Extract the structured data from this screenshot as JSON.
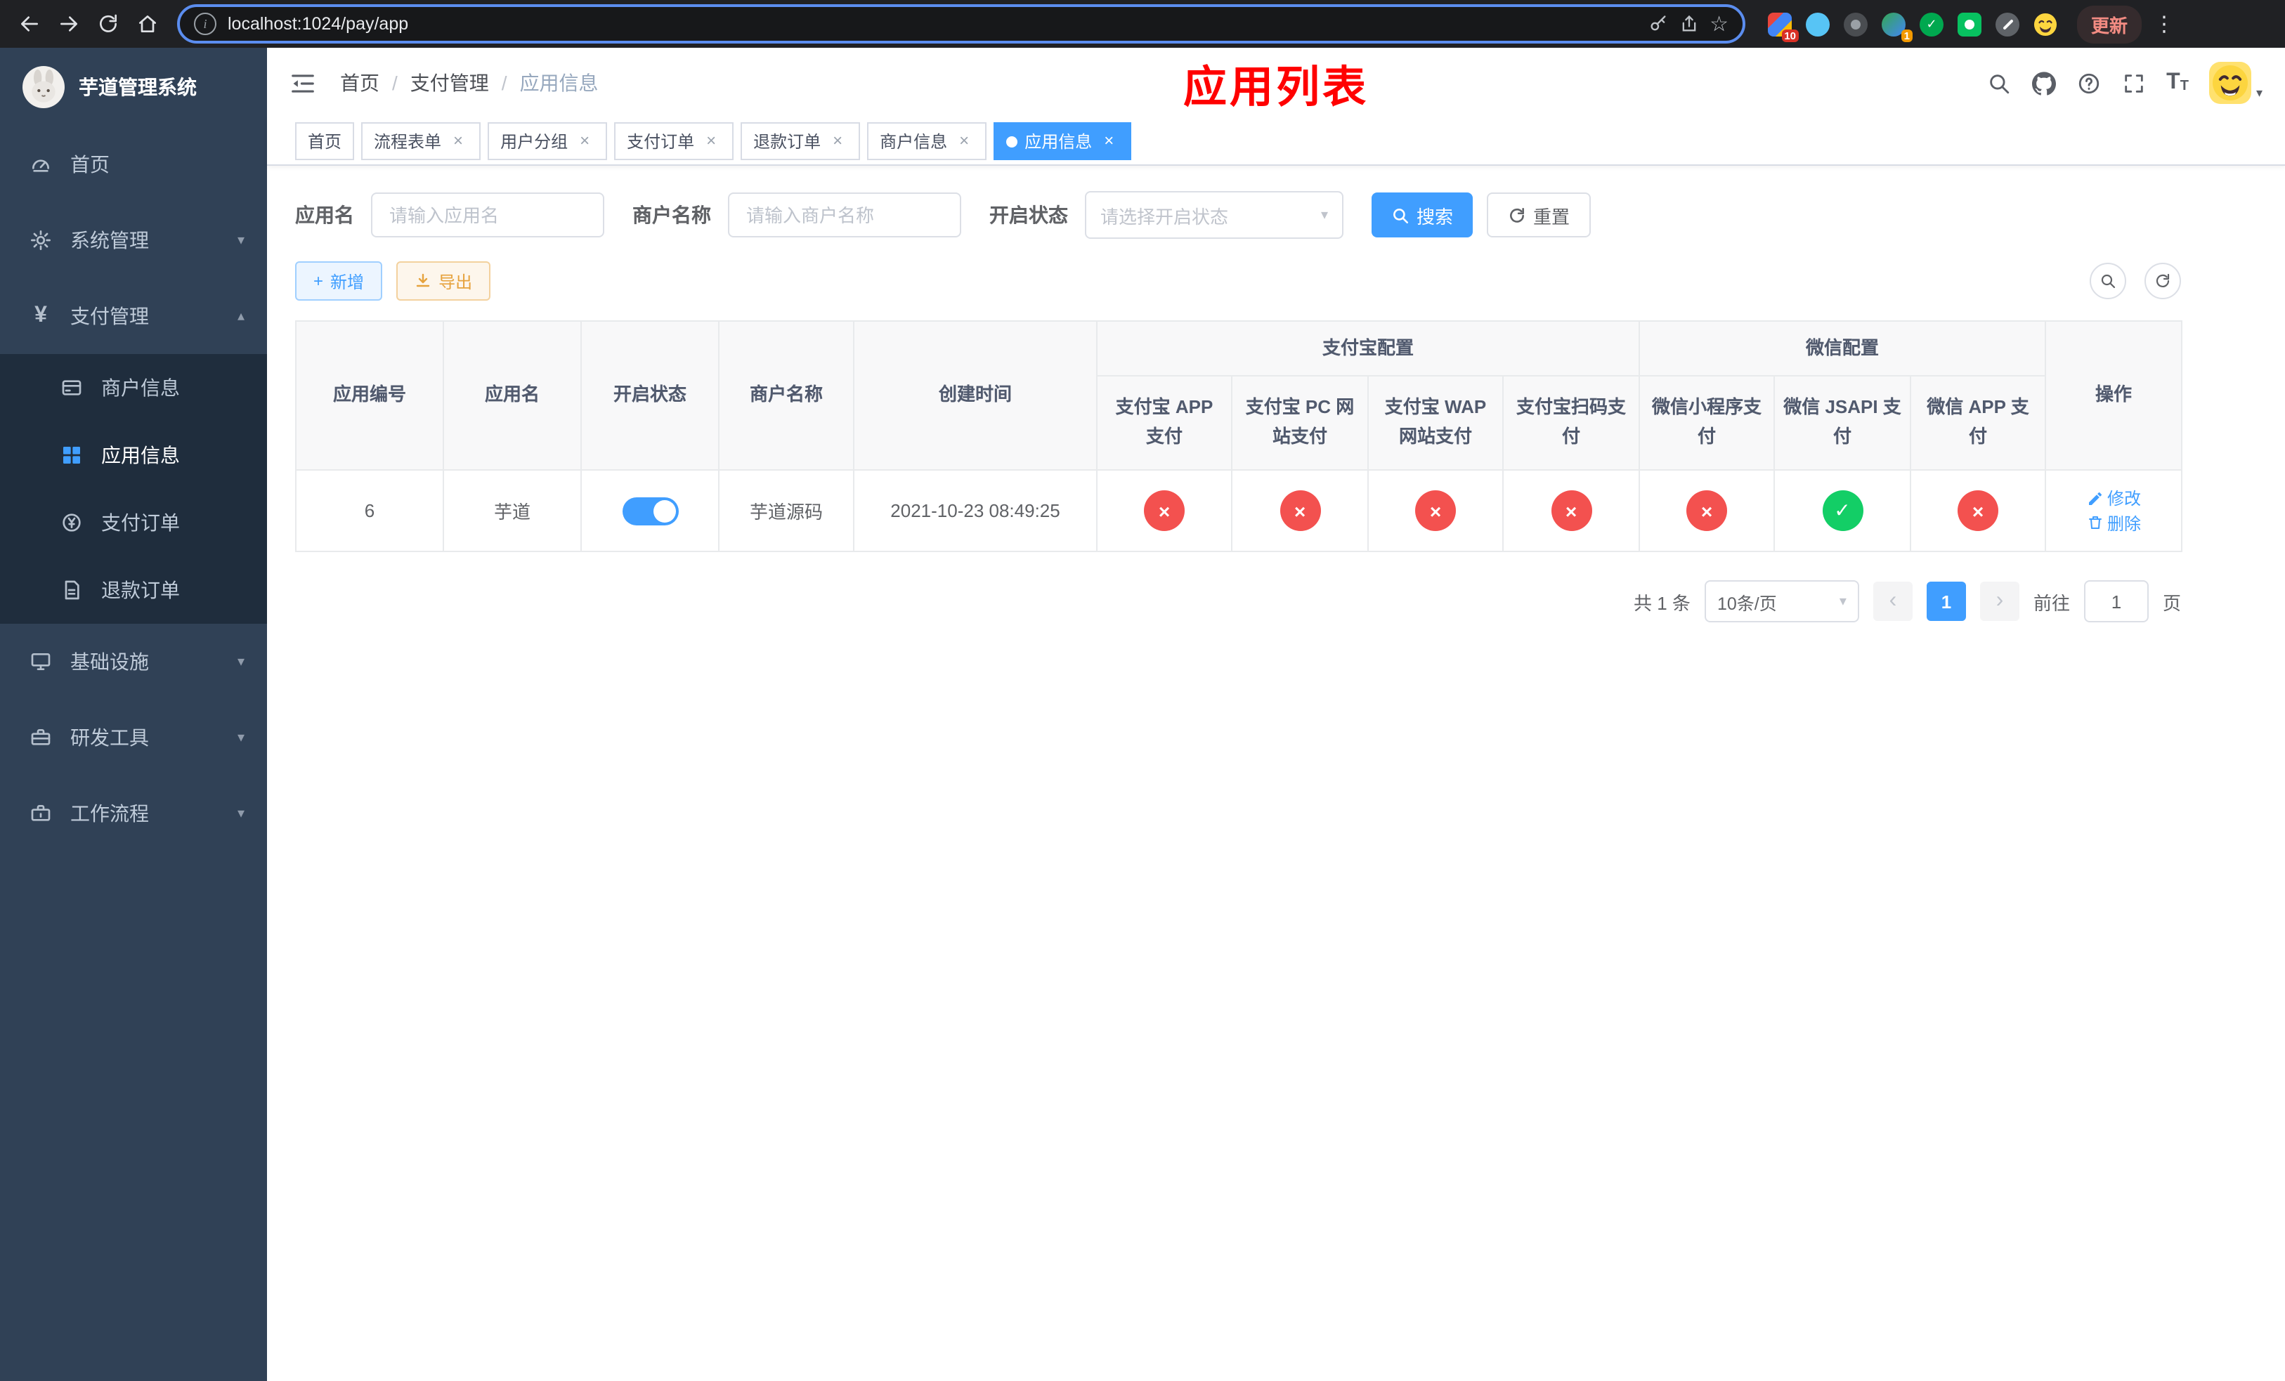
{
  "icons": {
    "close": "×",
    "caret": "▾",
    "chevron_down": "▾",
    "chevron_up": "▴",
    "check": "✓",
    "cross": "×",
    "star": "☆",
    "dots": "⋮",
    "info": "i",
    "plus": "+",
    "prev": "‹",
    "next": "›",
    "text_size_big": "T",
    "text_size_small": "T",
    "yen": "¥"
  },
  "browser": {
    "url": "localhost:1024/pay/app",
    "update_label": "更新",
    "ext_badge_a": "10",
    "ext_badge_b": "1"
  },
  "sidebar": {
    "title": "芋道管理系统",
    "items": [
      {
        "label": "首页"
      },
      {
        "label": "系统管理"
      },
      {
        "label": "支付管理"
      },
      {
        "label": "商户信息"
      },
      {
        "label": "应用信息"
      },
      {
        "label": "支付订单"
      },
      {
        "label": "退款订单"
      },
      {
        "label": "基础设施"
      },
      {
        "label": "研发工具"
      },
      {
        "label": "工作流程"
      }
    ]
  },
  "header": {
    "breadcrumb": [
      "首页",
      "支付管理",
      "应用信息"
    ],
    "separator": "/",
    "annotation": "应用列表"
  },
  "tabs": [
    {
      "label": "首页"
    },
    {
      "label": "流程表单"
    },
    {
      "label": "用户分组"
    },
    {
      "label": "支付订单"
    },
    {
      "label": "退款订单"
    },
    {
      "label": "商户信息"
    },
    {
      "label": "应用信息"
    }
  ],
  "filters": {
    "app_name_label": "应用名",
    "app_name_placeholder": "请输入应用名",
    "merchant_label": "商户名称",
    "merchant_placeholder": "请输入商户名称",
    "status_label": "开启状态",
    "status_placeholder": "请选择开启状态",
    "search_label": "搜索",
    "reset_label": "重置"
  },
  "toolbar": {
    "add_label": "新增",
    "export_label": "导出"
  },
  "table": {
    "headers": {
      "id": "应用编号",
      "name": "应用名",
      "status": "开启状态",
      "merchant": "商户名称",
      "created": "创建时间",
      "alipay_group": "支付宝配置",
      "wechat_group": "微信配置",
      "cols": [
        "支付宝 APP 支付",
        "支付宝 PC 网站支付",
        "支付宝 WAP 网站支付",
        "支付宝扫码支付",
        "微信小程序支付",
        "微信 JSAPI 支付",
        "微信 APP 支付"
      ],
      "actions": "操作"
    },
    "row": {
      "id": "6",
      "name": "芋道",
      "enabled": true,
      "merchant": "芋道源码",
      "created": "2021-10-23 08:49:25",
      "configs": [
        false,
        false,
        false,
        false,
        false,
        true,
        false
      ],
      "edit_label": "修改",
      "delete_label": "删除"
    }
  },
  "pagination": {
    "total": "共 1 条",
    "page_size": "10条/页",
    "page": "1",
    "goto_prefix": "前往",
    "goto_value": "1",
    "goto_suffix": "页"
  }
}
